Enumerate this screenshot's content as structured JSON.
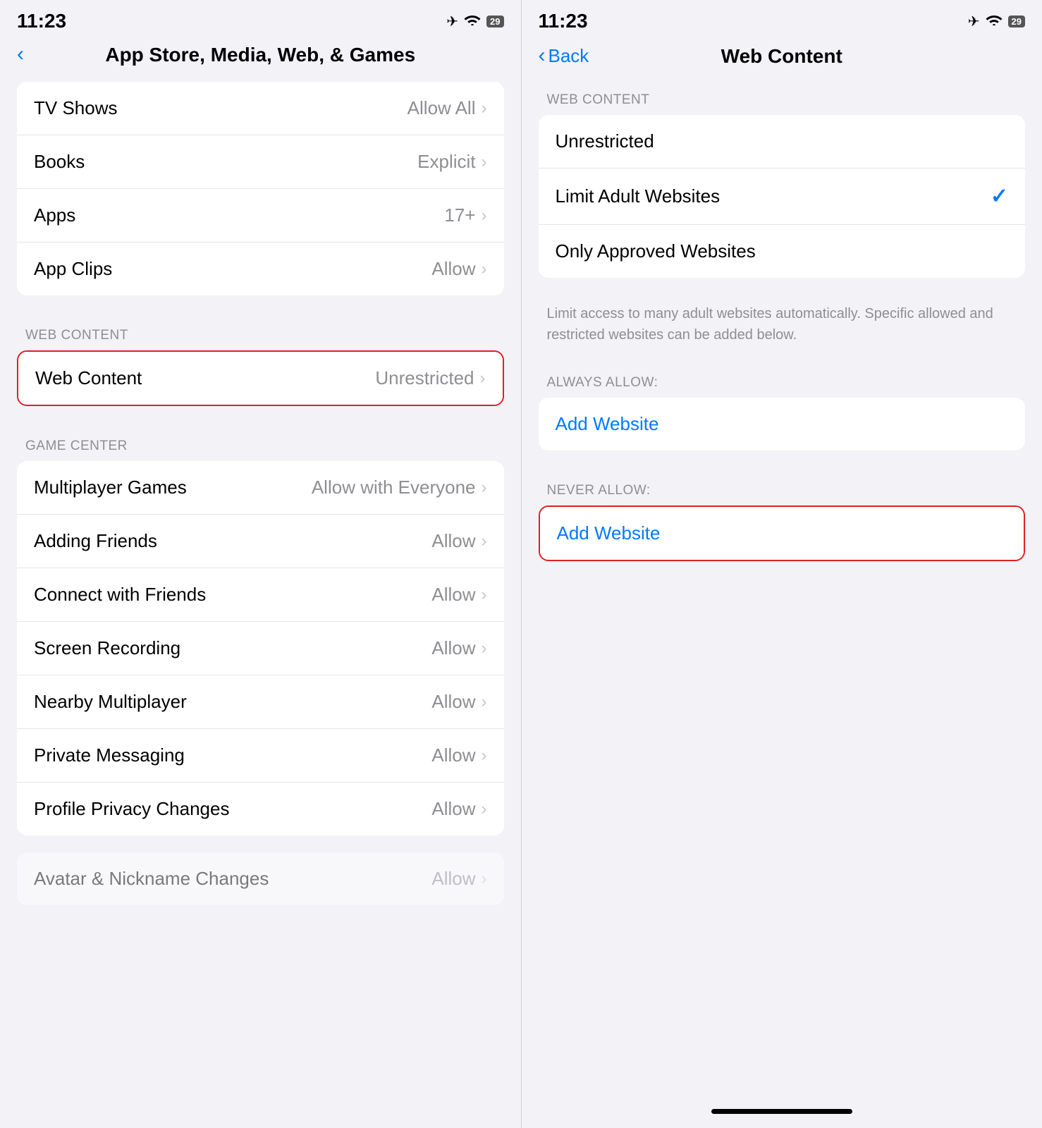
{
  "left_panel": {
    "status": {
      "time": "11:23",
      "airplane": "✈",
      "wifi": "WiFi",
      "battery": "29"
    },
    "nav": {
      "back_label": "",
      "title": "App Store, Media, Web, & Games"
    },
    "sections": [
      {
        "id": "top-group",
        "header": null,
        "items": [
          {
            "label": "TV Shows",
            "value": "Allow All"
          },
          {
            "label": "Books",
            "value": "Explicit"
          },
          {
            "label": "Apps",
            "value": "17+"
          },
          {
            "label": "App Clips",
            "value": "Allow"
          }
        ]
      },
      {
        "id": "web-content-group",
        "header": "WEB CONTENT",
        "items": [
          {
            "label": "Web Content",
            "value": "Unrestricted",
            "highlight": true
          }
        ]
      },
      {
        "id": "game-center-group",
        "header": "GAME CENTER",
        "items": [
          {
            "label": "Multiplayer Games",
            "value": "Allow with Everyone"
          },
          {
            "label": "Adding Friends",
            "value": "Allow"
          },
          {
            "label": "Connect with Friends",
            "value": "Allow"
          },
          {
            "label": "Screen Recording",
            "value": "Allow"
          },
          {
            "label": "Nearby Multiplayer",
            "value": "Allow"
          },
          {
            "label": "Private Messaging",
            "value": "Allow"
          },
          {
            "label": "Profile Privacy Changes",
            "value": "Allow"
          }
        ]
      },
      {
        "id": "bottom-partial",
        "header": null,
        "items": [
          {
            "label": "Avatar & Nickname Changes",
            "value": "Allow",
            "partial": true
          }
        ]
      }
    ]
  },
  "right_panel": {
    "status": {
      "time": "11:23",
      "airplane": "✈",
      "wifi": "WiFi",
      "battery": "29"
    },
    "nav": {
      "back_label": "Back",
      "title": "Web Content"
    },
    "web_content_section_label": "WEB CONTENT",
    "options": [
      {
        "label": "Unrestricted",
        "selected": false
      },
      {
        "label": "Limit Adult Websites",
        "selected": true
      },
      {
        "label": "Only Approved Websites",
        "selected": false
      }
    ],
    "description": "Limit access to many adult websites automatically. Specific allowed and restricted websites can be added below.",
    "always_allow_label": "ALWAYS ALLOW:",
    "add_website_always": "Add Website",
    "never_allow_label": "NEVER ALLOW:",
    "add_website_never": "Add Website"
  }
}
